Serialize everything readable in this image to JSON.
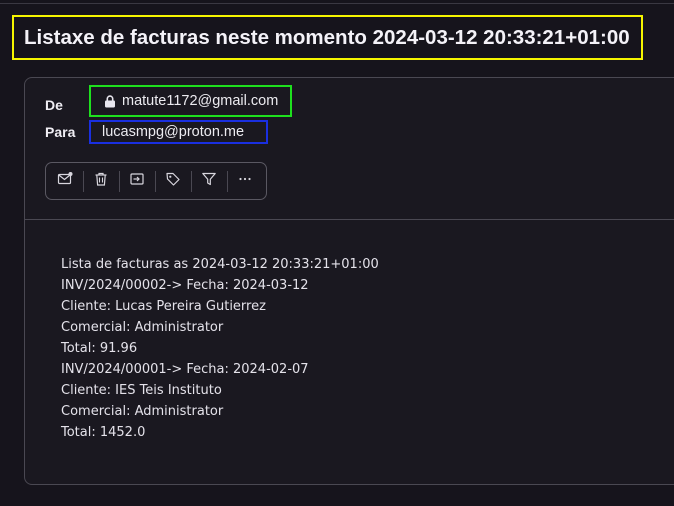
{
  "subject": "Listaxe de facturas neste momento 2024-03-12 20:33:21+01:00",
  "header": {
    "from_label": "De",
    "from_address": "matute1172@gmail.com",
    "from_icon": "lock-icon",
    "to_label": "Para",
    "to_address": "lucasmpg@proton.me"
  },
  "toolbar": {
    "buttons": [
      {
        "icon": "mark-unread-icon"
      },
      {
        "icon": "trash-icon"
      },
      {
        "icon": "move-to-folder-icon"
      },
      {
        "icon": "tag-icon"
      },
      {
        "icon": "filter-icon"
      },
      {
        "icon": "more-icon"
      }
    ]
  },
  "body": {
    "lines": [
      "Lista de facturas as 2024-03-12 20:33:21+01:00",
      "INV/2024/00002-> Fecha: 2024-03-12",
      "Cliente: Lucas Pereira Gutierrez",
      "Comercial: Administrator",
      "Total: 91.96",
      "INV/2024/00001-> Fecha: 2024-02-07",
      "Cliente: IES Teis Instituto",
      "Comercial: Administrator",
      "Total: 1452.0"
    ]
  },
  "colors": {
    "subject_highlight": "#f5f500",
    "from_highlight": "#1ee01e",
    "to_highlight": "#1a2fe0",
    "background": "#16141c"
  }
}
